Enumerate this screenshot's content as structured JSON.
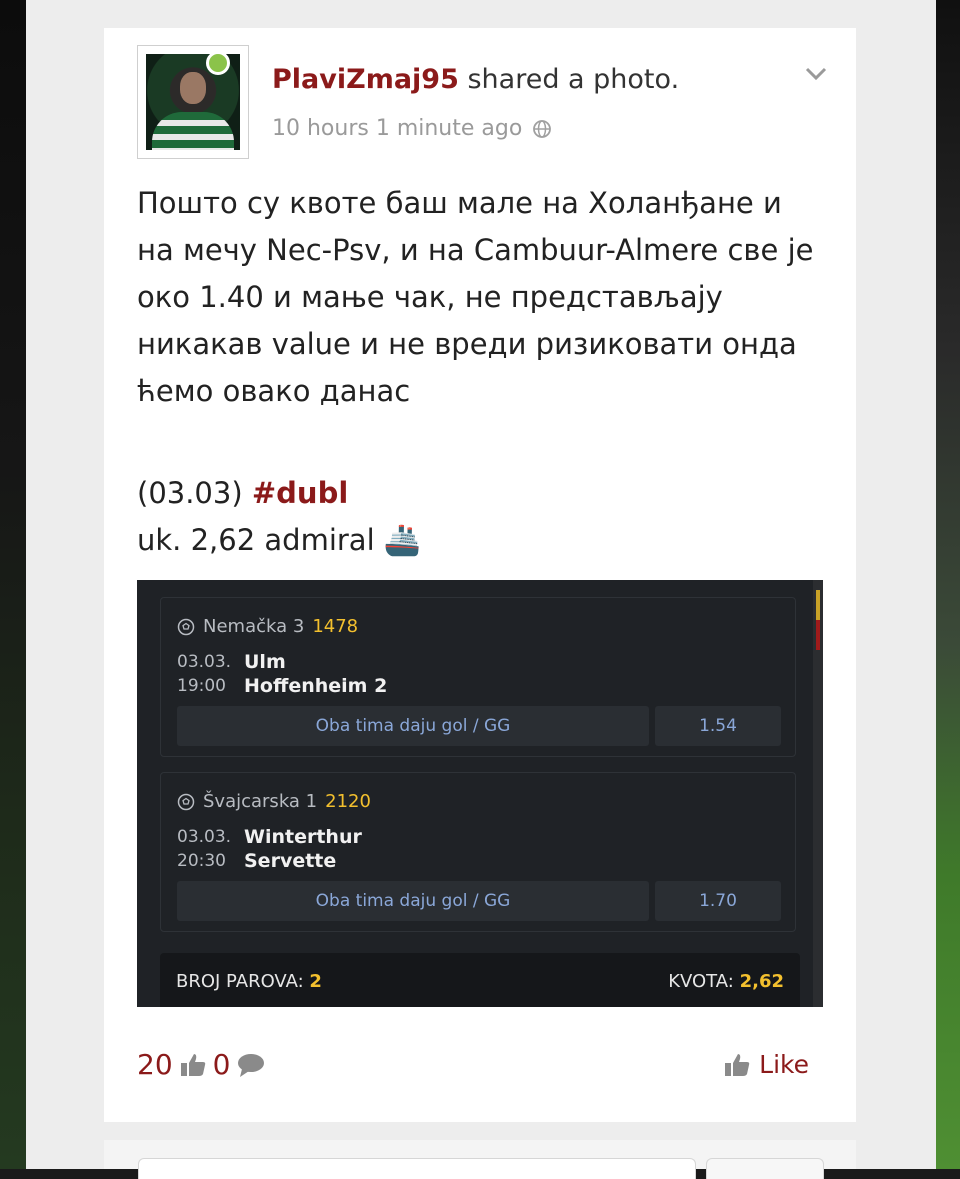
{
  "post": {
    "author": "PlaviZmaj95",
    "action": " shared a photo.",
    "time": "10 hours 1 minute ago",
    "body_lines": [
      "Пошто су квоте баш мале на Холанђане и",
      "на мечу Nec-Psv, и на Cambuur-Almere све је",
      "око 1.40 и мање чак, не представљају",
      "никакав value и не вреди ризиковати онда",
      "ћемо овако данас"
    ],
    "date_prefix": "(03.03) ",
    "hashtag": "#dubl",
    "odds_line": "uk. 2,62 admiral ",
    "ship_emoji": "🚢"
  },
  "ticket": {
    "matches": [
      {
        "league": "Nemačka 3",
        "code": "1478",
        "date": "03.03.",
        "time": "19:00",
        "home": "Ulm",
        "away": "Hoffenheim 2",
        "pick": "Oba tima daju gol / GG",
        "odd": "1.54"
      },
      {
        "league": "Švajcarska 1",
        "code": "2120",
        "date": "03.03.",
        "time": "20:30",
        "home": "Winterthur",
        "away": "Servette",
        "pick": "Oba tima daju gol / GG",
        "odd": "1.70"
      }
    ],
    "pairs_label": "BROJ PAROVA:",
    "pairs_value": "2",
    "total_label": "KVOTA:",
    "total_value": "2,62"
  },
  "footer": {
    "likes": "20",
    "comments": "0",
    "like_label": "Like"
  },
  "colors": {
    "accent": "#8b1a1a",
    "ticket_bg": "#1f2226",
    "ticket_yellow": "#f3c02e",
    "online": "#8bc34a"
  }
}
